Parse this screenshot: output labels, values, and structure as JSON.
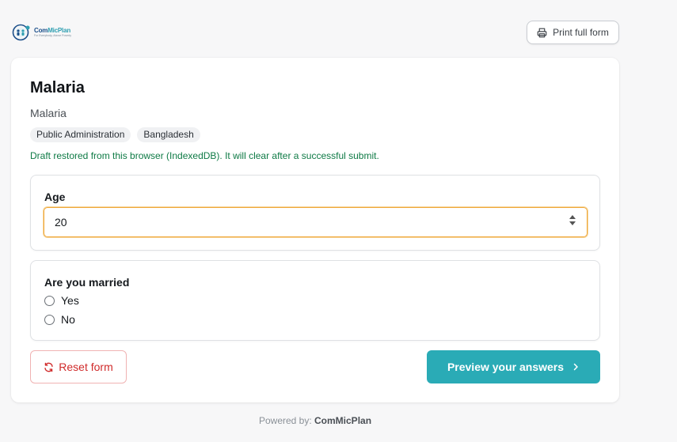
{
  "header": {
    "logo": {
      "name_part1": "Com",
      "name_part2": "MicPlan",
      "tagline": "For Everybody, Above Poverty",
      "icon": "community-health-logo"
    },
    "print_button": {
      "label": "Print full form",
      "icon": "printer-icon"
    }
  },
  "form": {
    "title": "Malaria",
    "subtitle": "Malaria",
    "tags": [
      "Public Administration",
      "Bangladesh"
    ],
    "draft_note": "Draft restored from this browser (IndexedDB). It will clear after a successful submit.",
    "questions": {
      "age": {
        "label": "Age",
        "value": "20"
      },
      "married": {
        "label": "Are you married",
        "options": [
          "Yes",
          "No"
        ]
      }
    },
    "reset_button": {
      "label": "Reset form",
      "icon": "refresh-icon"
    },
    "preview_button": {
      "label": "Preview your answers",
      "icon": "chevron-right-icon"
    }
  },
  "footer": {
    "powered_label": "Powered by:",
    "brand": "ComMicPlan"
  },
  "colors": {
    "accent": "#2aabb6",
    "danger": "#d02b2b",
    "success_text": "#0e7a45",
    "focus_border": "#f0a83a"
  }
}
